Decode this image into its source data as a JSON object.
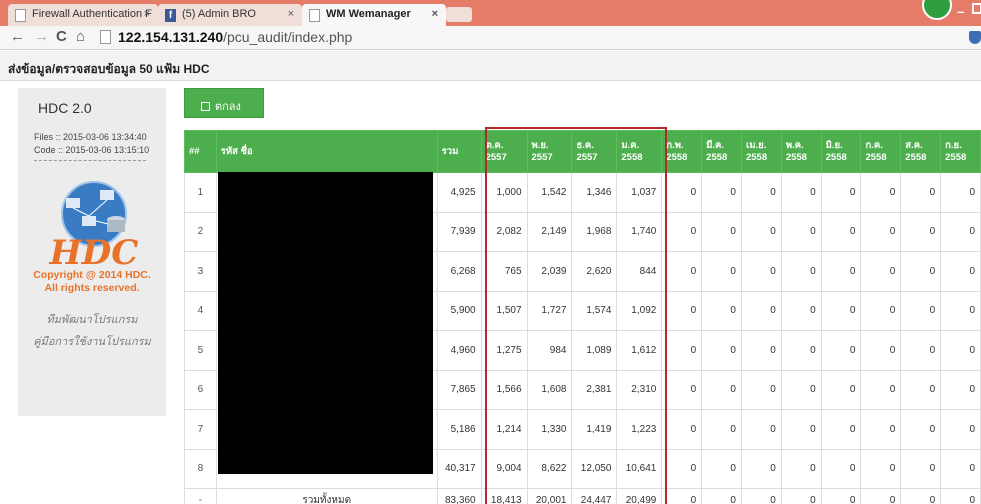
{
  "browser": {
    "tabs": [
      {
        "label": "Firewall Authentication F",
        "icon": "page-icon"
      },
      {
        "label": "(5) Admin BRO",
        "icon": "facebook-icon"
      },
      {
        "label": "WM Wemanager",
        "icon": "page-icon"
      }
    ],
    "url_host": "122.154.131.240",
    "url_path": "/pcu_audit/index.php"
  },
  "page": {
    "header": "ส่งข้อมูล/ตรวจสอบข้อมูล 50 แฟ้ม HDC",
    "ok_button": "ตกลง"
  },
  "sidebar": {
    "title": "HDC 2.0",
    "files_line": "Files :: 2015-03-06 13:34:40",
    "code_line": "Code :: 2015-03-06 13:15:10",
    "logo_text": "HDC",
    "copyright_1": "Copyright @ 2014 HDC.",
    "copyright_2": "All rights reserved.",
    "link_team": "ทีมพัฒนาโปรแกรม",
    "link_manual": "คู่มือการใช้งานโปรแกรม"
  },
  "table": {
    "headers": {
      "idx": "##",
      "code": "รหัส ชื่อ",
      "sum": "รวม",
      "months": [
        "ต.ค. 2557",
        "พ.ย. 2557",
        "ธ.ค. 2557",
        "ม.ค. 2558",
        "ก.พ. 2558",
        "มี.ค. 2558",
        "เม.ย. 2558",
        "พ.ค. 2558",
        "มิ.ย. 2558",
        "ก.ค. 2558",
        "ส.ค. 2558",
        "ก.ย. 2558"
      ]
    },
    "rows": [
      {
        "idx": "1",
        "sum": "4,925",
        "months": [
          "1,000",
          "1,542",
          "1,346",
          "1,037",
          "0",
          "0",
          "0",
          "0",
          "0",
          "0",
          "0",
          "0"
        ]
      },
      {
        "idx": "2",
        "sum": "7,939",
        "months": [
          "2,082",
          "2,149",
          "1,968",
          "1,740",
          "0",
          "0",
          "0",
          "0",
          "0",
          "0",
          "0",
          "0"
        ]
      },
      {
        "idx": "3",
        "sum": "6,268",
        "months": [
          "765",
          "2,039",
          "2,620",
          "844",
          "0",
          "0",
          "0",
          "0",
          "0",
          "0",
          "0",
          "0"
        ]
      },
      {
        "idx": "4",
        "sum": "5,900",
        "months": [
          "1,507",
          "1,727",
          "1,574",
          "1,092",
          "0",
          "0",
          "0",
          "0",
          "0",
          "0",
          "0",
          "0"
        ]
      },
      {
        "idx": "5",
        "sum": "4,960",
        "months": [
          "1,275",
          "984",
          "1,089",
          "1,612",
          "0",
          "0",
          "0",
          "0",
          "0",
          "0",
          "0",
          "0"
        ]
      },
      {
        "idx": "6",
        "sum": "7,865",
        "months": [
          "1,566",
          "1,608",
          "2,381",
          "2,310",
          "0",
          "0",
          "0",
          "0",
          "0",
          "0",
          "0",
          "0"
        ]
      },
      {
        "idx": "7",
        "sum": "5,186",
        "months": [
          "1,214",
          "1,330",
          "1,419",
          "1,223",
          "0",
          "0",
          "0",
          "0",
          "0",
          "0",
          "0",
          "0"
        ]
      },
      {
        "idx": "8",
        "sum": "40,317",
        "months": [
          "9,004",
          "8,622",
          "12,050",
          "10,641",
          "0",
          "0",
          "0",
          "0",
          "0",
          "0",
          "0",
          "0"
        ]
      }
    ],
    "total": {
      "idx": "-",
      "label": "รวมทั้งหมด",
      "sum": "83,360",
      "months": [
        "18,413",
        "20,001",
        "24,447",
        "20,499",
        "0",
        "0",
        "0",
        "0",
        "0",
        "0",
        "0",
        "0"
      ]
    }
  },
  "colors": {
    "tabbar": "#e67b67",
    "header_green": "#4cae4c",
    "highlight_red": "#b72828",
    "logo_orange": "#e8722a"
  }
}
